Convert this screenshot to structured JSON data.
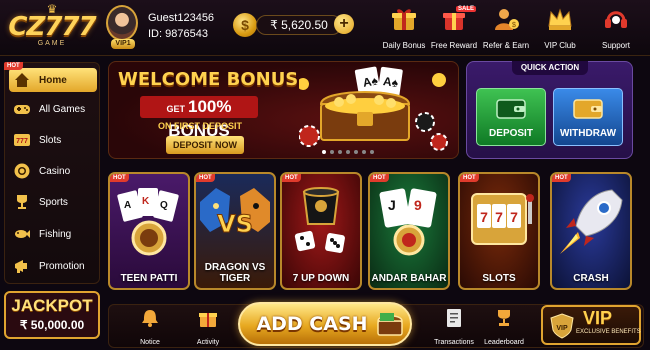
{
  "brand": {
    "logo": "CZ777",
    "logo_sub": "GAME"
  },
  "user": {
    "name": "Guest123456",
    "id": "ID: 9876543",
    "vip": "VIP1"
  },
  "wallet": {
    "coin_glyph": "$",
    "balance": "₹ 5,620.50",
    "add_glyph": "+"
  },
  "header_nav": [
    {
      "label": "Daily Bonus",
      "icon": "gift-icon"
    },
    {
      "label": "Free Reward",
      "icon": "reward-gift-icon",
      "tag": "SALE"
    },
    {
      "label": "Refer & Earn",
      "icon": "refer-user-icon"
    },
    {
      "label": "VIP Club",
      "icon": "crown-icon"
    },
    {
      "label": "Support",
      "icon": "headset-icon"
    }
  ],
  "sidebar": {
    "hot_tag": "HOT",
    "items": [
      {
        "label": "Home",
        "icon": "home-icon",
        "active": true
      },
      {
        "label": "All Games",
        "icon": "gamepad-icon"
      },
      {
        "label": "Slots",
        "icon": "slot-777-icon"
      },
      {
        "label": "Casino",
        "icon": "chip-icon"
      },
      {
        "label": "Sports",
        "icon": "trophy-icon"
      },
      {
        "label": "Fishing",
        "icon": "fish-icon"
      },
      {
        "label": "Promotion",
        "icon": "megaphone-icon"
      }
    ]
  },
  "jackpot": {
    "title": "JACKPOT",
    "amount": "₹ 50,000.00"
  },
  "banner": {
    "title": "WELCOME BONUS",
    "bonus_prefix": "GET",
    "bonus_main": "100% BONUS",
    "subtitle": "ON FIRST DEPOSIT",
    "cta": "DEPOSIT NOW",
    "slide_count": 7,
    "active_slide": 0
  },
  "quick_action": {
    "title": "QUICK ACTION",
    "deposit": "DEPOSIT",
    "withdraw": "WITHDRAW"
  },
  "games": [
    {
      "name": "TEEN PATTI",
      "tag": "HOT",
      "icon": "cards-chip-icon"
    },
    {
      "name": "DRAGON VS TIGER",
      "tag": "HOT",
      "icon": "dragon-tiger-icon"
    },
    {
      "name": "7 UP DOWN",
      "tag": "HOT",
      "icon": "dice-cup-icon"
    },
    {
      "name": "ANDAR BAHAR",
      "tag": "HOT",
      "icon": "cards-icon"
    },
    {
      "name": "SLOTS",
      "tag": "HOT",
      "icon": "slot-machine-icon"
    },
    {
      "name": "CRASH",
      "tag": "HOT",
      "icon": "rocket-icon"
    }
  ],
  "bottom_nav": [
    {
      "label": "Notice",
      "icon": "bell-icon"
    },
    {
      "label": "Activity",
      "icon": "gift-box-icon"
    },
    {
      "label": "Transactions",
      "icon": "receipt-icon"
    },
    {
      "label": "Leaderboard",
      "icon": "trophy-icon"
    }
  ],
  "add_cash": "ADD CASH",
  "vip": {
    "title": "VIP",
    "subtitle": "EXCLUSIVE BENEFITS"
  },
  "colors": {
    "gold": "#ffd24f",
    "hot_red": "#e03b2c",
    "deposit_green": "#1f9a38",
    "withdraw_blue": "#2a6ac8",
    "quick_purple": "#3a1a6a"
  }
}
